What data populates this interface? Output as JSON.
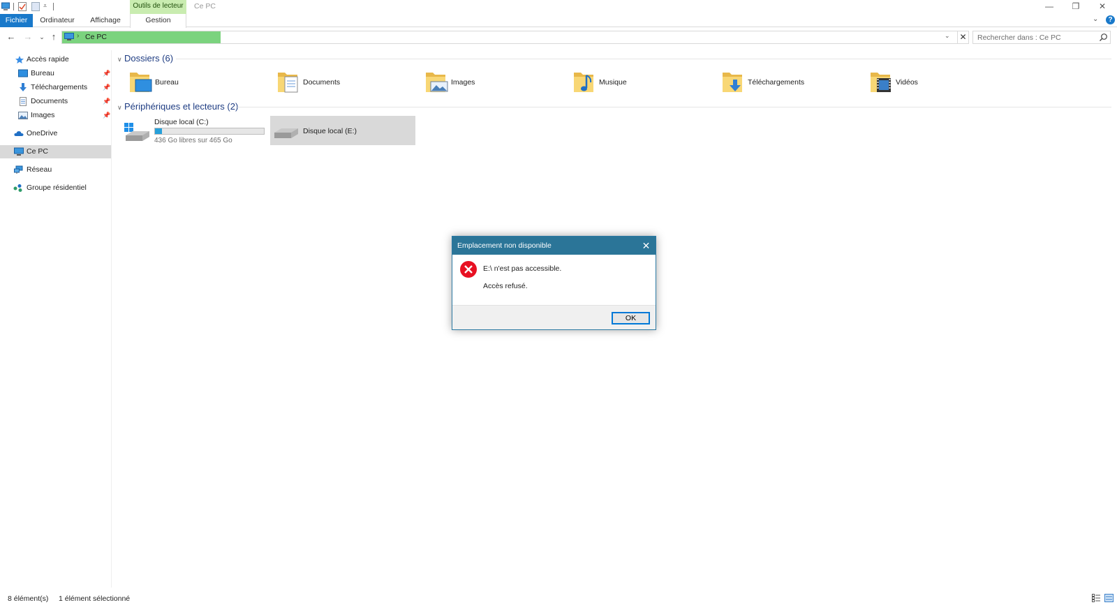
{
  "window": {
    "title": "Ce PC",
    "contextual_tab_header": "Outils de lecteur",
    "controls": {
      "minimize": "—",
      "restore": "❐",
      "close": "✕"
    }
  },
  "ribbon": {
    "tabs": [
      {
        "label": "Fichier",
        "active": true
      },
      {
        "label": "Ordinateur"
      },
      {
        "label": "Affichage"
      },
      {
        "label": "Gestion"
      }
    ],
    "help": "?"
  },
  "navigation": {
    "back": "←",
    "forward": "→",
    "recent": "⌄",
    "up": "↑",
    "address_separator": "›",
    "address_path": "Ce PC",
    "search_placeholder": "Rechercher dans : Ce PC"
  },
  "sidebar": {
    "items": [
      {
        "label": "Accès rapide",
        "icon": "star-icon"
      },
      {
        "label": "Bureau",
        "icon": "desktop-icon",
        "pinned": true
      },
      {
        "label": "Téléchargements",
        "icon": "download-icon",
        "pinned": true
      },
      {
        "label": "Documents",
        "icon": "document-icon",
        "pinned": true
      },
      {
        "label": "Images",
        "icon": "pictures-icon",
        "pinned": true
      },
      {
        "label": "OneDrive",
        "icon": "cloud-icon"
      },
      {
        "label": "Ce PC",
        "icon": "computer-icon",
        "selected": true
      },
      {
        "label": "Réseau",
        "icon": "network-icon"
      },
      {
        "label": "Groupe résidentiel",
        "icon": "homegroup-icon"
      }
    ]
  },
  "content": {
    "folders_header": "Dossiers (6)",
    "folders": [
      {
        "label": "Bureau",
        "icon": "desktop-folder-icon"
      },
      {
        "label": "Documents",
        "icon": "documents-folder-icon"
      },
      {
        "label": "Images",
        "icon": "pictures-folder-icon"
      },
      {
        "label": "Musique",
        "icon": "music-folder-icon"
      },
      {
        "label": "Téléchargements",
        "icon": "downloads-folder-icon"
      },
      {
        "label": "Vidéos",
        "icon": "videos-folder-icon"
      }
    ],
    "drives_header": "Périphériques et lecteurs (2)",
    "drives": [
      {
        "name": "Disque local (C:)",
        "free": "436 Go libres sur 465 Go",
        "used_fraction": 0.062
      },
      {
        "name": "Disque local (E:)",
        "selected": true
      }
    ]
  },
  "status": {
    "count": "8 élément(s)",
    "selection": "1 élément sélectionné"
  },
  "dialog": {
    "title": "Emplacement non disponible",
    "message": "E:\\ n'est pas accessible.",
    "detail": "Accès refusé.",
    "ok_label": "OK",
    "close": "✕"
  },
  "colors": {
    "accent": "#1979ca",
    "dialog_title": "#2b7598",
    "address_progress": "#7bd37e",
    "context_tab": "#c9ecb0",
    "error": "#e81123"
  }
}
